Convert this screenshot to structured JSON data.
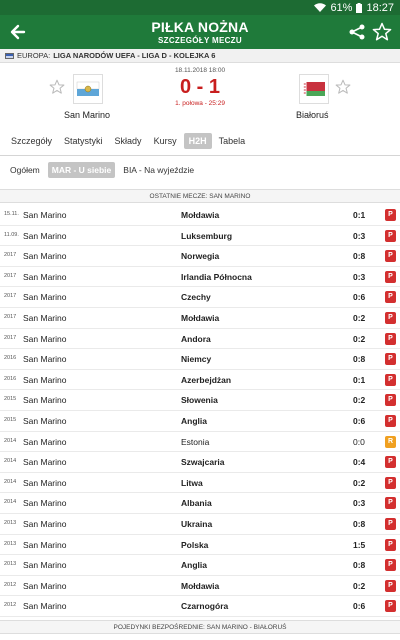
{
  "status_bar": {
    "battery": "61%",
    "time": "18:27"
  },
  "header": {
    "title": "PIŁKA NOŻNA",
    "subtitle": "SZCZEGÓŁY MECZU"
  },
  "league": {
    "region": "EUROPA:",
    "name": "LIGA NARODÓW UEFA - LIGA D - KOLEJKA 6"
  },
  "match": {
    "datetime": "18.11.2018 18:00",
    "score": "0 - 1",
    "status": "1. połowa - 25:29",
    "home": "San Marino",
    "away": "Białoruś"
  },
  "tabs": [
    "Szczegóły",
    "Statystyki",
    "Składy",
    "Kursy",
    "H2H",
    "Tabela"
  ],
  "active_tab": "H2H",
  "subtabs": [
    "Ogółem",
    "MAR - U siebie",
    "BIA - Na wyjeździe"
  ],
  "active_subtab": "MAR - U siebie",
  "section_title": "OSTATNIE MECZE: SAN MARINO",
  "footer_section": "POJEDYNKI BEZPOŚREDNIE: SAN MARINO - BIAŁORUŚ",
  "colors": {
    "header_green": "#1f7a3a",
    "loss_red": "#d32f2f",
    "draw_orange": "#f0a020",
    "score_red": "#c81e1e"
  },
  "matches": [
    {
      "date": "15.11.",
      "home": "San Marino",
      "away": "Mołdawia",
      "score": "0:1",
      "result": "P"
    },
    {
      "date": "11.09.",
      "home": "San Marino",
      "away": "Luksemburg",
      "score": "0:3",
      "result": "P"
    },
    {
      "date": "2017",
      "home": "San Marino",
      "away": "Norwegia",
      "score": "0:8",
      "result": "P"
    },
    {
      "date": "2017",
      "home": "San Marino",
      "away": "Irlandia Północna",
      "score": "0:3",
      "result": "P"
    },
    {
      "date": "2017",
      "home": "San Marino",
      "away": "Czechy",
      "score": "0:6",
      "result": "P"
    },
    {
      "date": "2017",
      "home": "San Marino",
      "away": "Mołdawia",
      "score": "0:2",
      "result": "P"
    },
    {
      "date": "2017",
      "home": "San Marino",
      "away": "Andora",
      "score": "0:2",
      "result": "P"
    },
    {
      "date": "2016",
      "home": "San Marino",
      "away": "Niemcy",
      "score": "0:8",
      "result": "P"
    },
    {
      "date": "2016",
      "home": "San Marino",
      "away": "Azerbejdżan",
      "score": "0:1",
      "result": "P"
    },
    {
      "date": "2015",
      "home": "San Marino",
      "away": "Słowenia",
      "score": "0:2",
      "result": "P"
    },
    {
      "date": "2015",
      "home": "San Marino",
      "away": "Anglia",
      "score": "0:6",
      "result": "P"
    },
    {
      "date": "2014",
      "home": "San Marino",
      "away": "Estonia",
      "score": "0:0",
      "result": "R"
    },
    {
      "date": "2014",
      "home": "San Marino",
      "away": "Szwajcaria",
      "score": "0:4",
      "result": "P"
    },
    {
      "date": "2014",
      "home": "San Marino",
      "away": "Litwa",
      "score": "0:2",
      "result": "P"
    },
    {
      "date": "2014",
      "home": "San Marino",
      "away": "Albania",
      "score": "0:3",
      "result": "P"
    },
    {
      "date": "2013",
      "home": "San Marino",
      "away": "Ukraina",
      "score": "0:8",
      "result": "P"
    },
    {
      "date": "2013",
      "home": "San Marino",
      "away": "Polska",
      "score": "1:5",
      "result": "P"
    },
    {
      "date": "2013",
      "home": "San Marino",
      "away": "Anglia",
      "score": "0:8",
      "result": "P"
    },
    {
      "date": "2012",
      "home": "San Marino",
      "away": "Mołdawia",
      "score": "0:2",
      "result": "P"
    },
    {
      "date": "2012",
      "home": "San Marino",
      "away": "Czarnogóra",
      "score": "0:6",
      "result": "P"
    }
  ]
}
